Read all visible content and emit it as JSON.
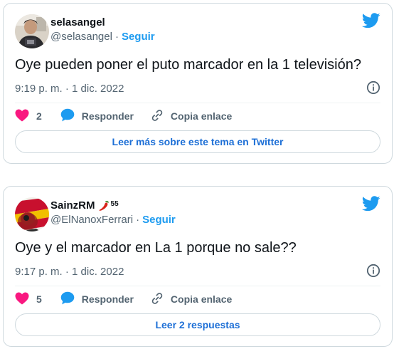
{
  "colors": {
    "twitter_blue": "#1d9bf0",
    "like_red": "#f91880",
    "text_primary": "#0f1419",
    "text_secondary": "#536471",
    "border": "#cfd9de"
  },
  "tweets": [
    {
      "display_name": "selasangel",
      "handle": "@selasangel",
      "separator": "·",
      "follow_label": "Seguir",
      "text": "Oye pueden poner el puto marcador en la 1 televisión?",
      "timestamp": "9:19 p. m. · 1 dic. 2022",
      "likes": "2",
      "reply_label": "Responder",
      "copy_label": "Copia enlace",
      "read_more_label": "Leer más sobre este tema en Twitter",
      "icons": {
        "logo": "twitter-bird-icon",
        "info": "info-icon",
        "like": "heart-icon",
        "reply": "speech-bubble-icon",
        "copy": "link-icon"
      }
    },
    {
      "display_name": "SainzRM",
      "badge_count": "55",
      "handle": "@ElNanoxFerrari",
      "separator": "·",
      "follow_label": "Seguir",
      "text": "Oye y el marcador en La 1 porque no sale??",
      "timestamp": "9:17 p. m. · 1 dic. 2022",
      "likes": "5",
      "reply_label": "Responder",
      "copy_label": "Copia enlace",
      "read_more_label": "Leer 2 respuestas",
      "icons": {
        "logo": "twitter-bird-icon",
        "info": "info-icon",
        "like": "heart-icon",
        "reply": "speech-bubble-icon",
        "copy": "link-icon",
        "badge": "chili-pepper-icon"
      }
    }
  ]
}
